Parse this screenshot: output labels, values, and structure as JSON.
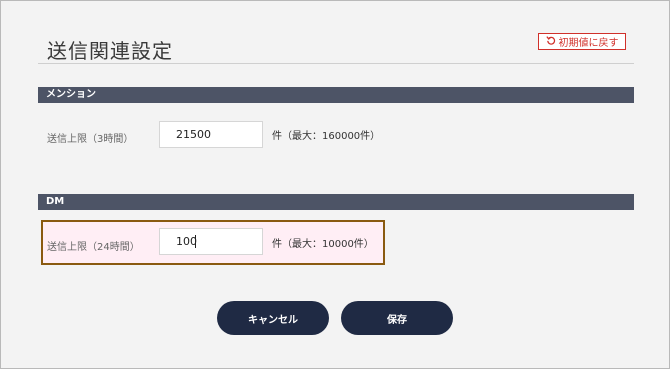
{
  "page": {
    "title": "送信関連設定",
    "reset_label": "初期値に戻す"
  },
  "sections": {
    "mention": {
      "header": "メンション",
      "label": "送信上限（3時間）",
      "value": "21500",
      "note": "件（最大：160000件）"
    },
    "dm": {
      "header": "DM",
      "label": "送信上限（24時間）",
      "value": "100",
      "note": "件（最大：10000件）"
    }
  },
  "buttons": {
    "cancel": "キャンセル",
    "save": "保存"
  },
  "colors": {
    "section_bar": "#4d5466",
    "primary_button": "#1f2a44",
    "reset_accent": "#d0302a",
    "highlight_border": "#8a5a10"
  },
  "icons": {
    "reset": "undo-icon"
  }
}
